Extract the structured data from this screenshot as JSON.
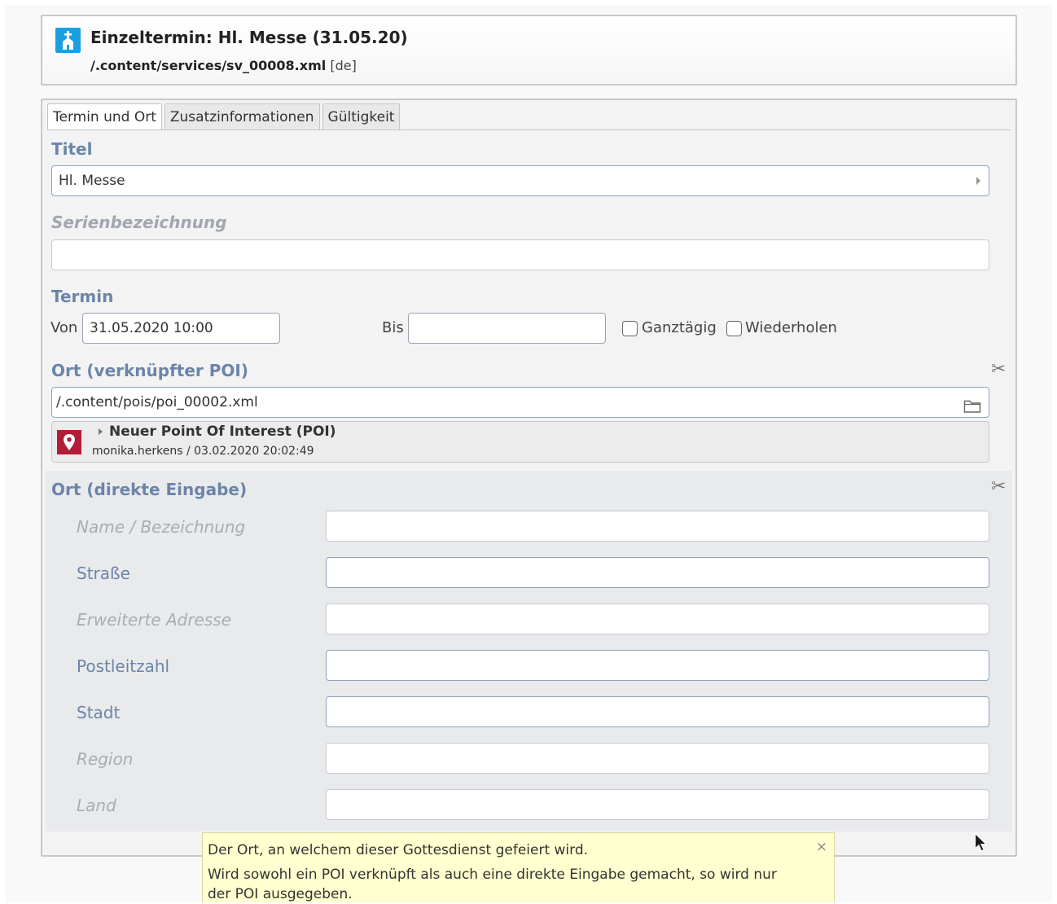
{
  "header": {
    "title": "Einzeltermin: Hl. Messe (31.05.20)",
    "path": "/.content/services/sv_00008.xml",
    "locale": "[de]",
    "type_icon": "church-icon",
    "accent_color": "#1aa0df"
  },
  "tabs": [
    {
      "label": "Termin und Ort",
      "active": true
    },
    {
      "label": "Zusatzinformationen",
      "active": false
    },
    {
      "label": "Gültigkeit",
      "active": false
    }
  ],
  "form": {
    "titel": {
      "label": "Titel",
      "value": "Hl. Messe"
    },
    "serien": {
      "label": "Serienbezeichnung",
      "value": ""
    },
    "termin": {
      "label": "Termin",
      "von_label": "Von",
      "von_value": "31.05.2020 10:00",
      "bis_label": "Bis",
      "bis_value": "",
      "ganztaegig_label": "Ganztägig",
      "ganztaegig_checked": false,
      "wiederholen_label": "Wiederholen",
      "wiederholen_checked": false
    },
    "ort_poi": {
      "label": "Ort (verknüpfter POI)",
      "value": "/.content/pois/poi_00002.xml",
      "poi_title": "Neuer Point Of Interest (POI)",
      "poi_meta": "monika.herkens / 03.02.2020 20:02:49",
      "poi_icon_color": "#b11c37"
    },
    "ort_direkt": {
      "label": "Ort (direkte Eingabe)",
      "fields": [
        {
          "label": "Name / Bezeichnung",
          "value": "",
          "optional": true
        },
        {
          "label": "Straße",
          "value": "",
          "optional": false
        },
        {
          "label": "Erweiterte Adresse",
          "value": "",
          "optional": true
        },
        {
          "label": "Postleitzahl",
          "value": "",
          "optional": false
        },
        {
          "label": "Stadt",
          "value": "",
          "optional": false
        },
        {
          "label": "Region",
          "value": "",
          "optional": true
        },
        {
          "label": "Land",
          "value": "",
          "optional": true
        }
      ]
    }
  },
  "tooltip": {
    "line1": "Der Ort, an welchem dieser Gottesdienst gefeiert wird.",
    "line2": "Wird sowohl ein POI verknüpft als auch eine direkte Eingabe gemacht, so wird nur der POI ausgegeben.",
    "close": "×",
    "background": "#ffffcf"
  }
}
